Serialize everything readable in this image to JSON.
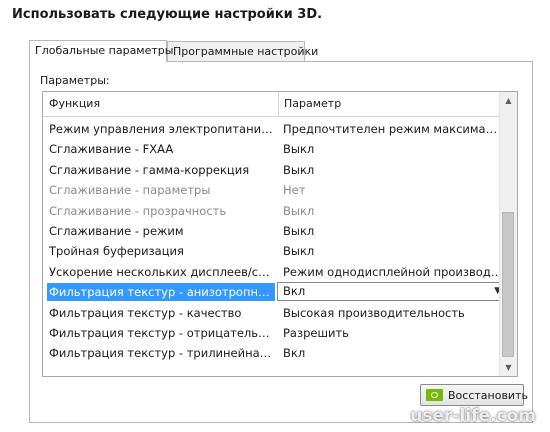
{
  "title": "Использовать следующие настройки 3D.",
  "tabs": [
    {
      "label": "Глобальные параметры",
      "active": true
    },
    {
      "label": "Программные настройки",
      "active": false
    }
  ],
  "params_label": "Параметры:",
  "table": {
    "headers": {
      "function": "Функция",
      "parameter": "Параметр"
    },
    "rows": [
      {
        "function": "Режим управления электропитанием",
        "value": "Предпочтителен режим максимальной п...",
        "state": "normal"
      },
      {
        "function": "Сглаживание - FXAA",
        "value": "Выкл",
        "state": "normal"
      },
      {
        "function": "Сглаживание - гамма-коррекция",
        "value": "Выкл",
        "state": "normal"
      },
      {
        "function": "Сглаживание - параметры",
        "value": "Нет",
        "state": "disabled"
      },
      {
        "function": "Сглаживание - прозрачность",
        "value": "Выкл",
        "state": "disabled"
      },
      {
        "function": "Сглаживание - режим",
        "value": "Выкл",
        "state": "normal"
      },
      {
        "function": "Тройная буферизация",
        "value": "Выкл",
        "state": "normal"
      },
      {
        "function": "Ускорение нескольких дисплеев/смеша...",
        "value": "Режим однодисплейной производитель...",
        "state": "normal"
      },
      {
        "function": "Фильтрация текстур - анизотропная оп...",
        "value": "Вкл",
        "state": "selected"
      },
      {
        "function": "Фильтрация текстур - качество",
        "value": "Высокая производительность",
        "state": "normal"
      },
      {
        "function": "Фильтрация текстур - отрицательное о...",
        "value": "Разрешить",
        "state": "normal"
      },
      {
        "function": "Фильтрация текстур - трилинейная опт...",
        "value": "Вкл",
        "state": "normal"
      }
    ]
  },
  "restore_button": {
    "label": "Восстановить",
    "icon": "nvidia-logo-icon"
  },
  "watermark": "user-life.com",
  "colors": {
    "selection": "#3399ff",
    "nvidia_green": "#76b900",
    "disabled_text": "#8a8a8a"
  }
}
